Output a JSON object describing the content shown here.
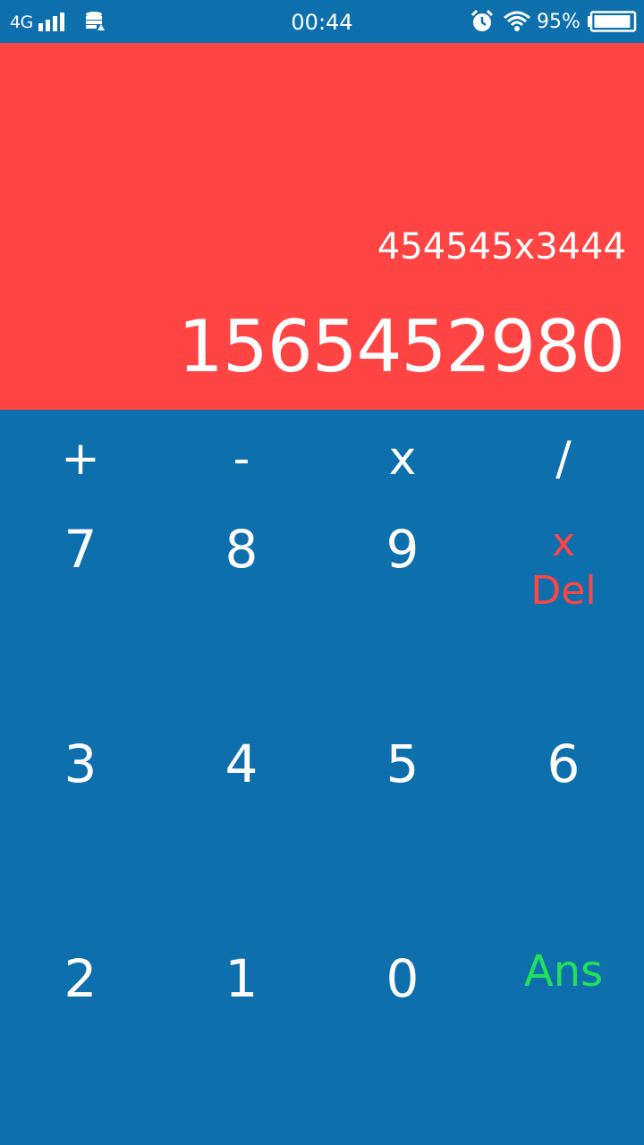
{
  "status_bar": {
    "network": "4G",
    "time": "00:44",
    "battery_percent": "95%",
    "battery_level": 0.95,
    "icons": [
      "signal-bars-icon",
      "data-saver-icon",
      "alarm-icon",
      "wifi-icon",
      "battery-icon"
    ]
  },
  "display": {
    "expression": "454545x3444",
    "result": "1565452980"
  },
  "keypad": {
    "operators": [
      "+",
      "-",
      "x",
      "/"
    ],
    "row1": [
      "7",
      "8",
      "9"
    ],
    "delete_top": "x",
    "delete_bottom": "Del",
    "row2": [
      "3",
      "4",
      "5",
      "6"
    ],
    "row3": [
      "2",
      "1",
      "0"
    ],
    "ans": "Ans"
  },
  "colors": {
    "primary_blue": "#0E6FAD",
    "display_red": "#FF4444",
    "delete_red": "#FF4444",
    "ans_green": "#22E05A",
    "text_white": "#FFFFFF"
  }
}
